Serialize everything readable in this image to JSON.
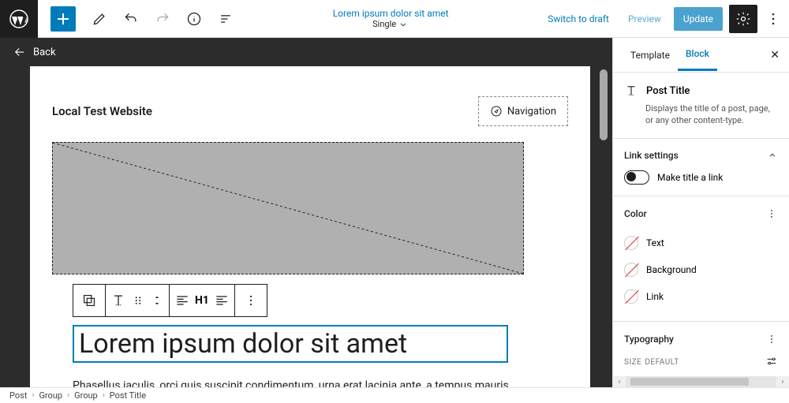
{
  "topbar": {
    "doc_title": "Lorem ipsum dolor sit amet",
    "doc_subtitle": "Single",
    "switch_draft": "Switch to draft",
    "preview": "Preview",
    "update": "Update"
  },
  "back": {
    "label": "Back"
  },
  "site": {
    "title": "Local Test Website",
    "nav_label": "Navigation"
  },
  "toolbar": {
    "heading": "H1"
  },
  "content": {
    "title": "Lorem ipsum dolor sit amet",
    "body": "Phasellus iaculis, orci quis suscipit condimentum, urna erat lacinia ante, a tempus mauris"
  },
  "sidebar": {
    "tabs": {
      "template": "Template",
      "block": "Block"
    },
    "block": {
      "name": "Post Title",
      "description": "Displays the title of a post, page, or any other content-type."
    },
    "link_settings": {
      "title": "Link settings",
      "toggle_label": "Make title a link"
    },
    "color": {
      "title": "Color",
      "text": "Text",
      "background": "Background",
      "link": "Link"
    },
    "typography": {
      "title": "Typography",
      "size_label": "SIZE",
      "size_value": "DEFAULT"
    }
  },
  "breadcrumb": {
    "post": "Post",
    "g1": "Group",
    "g2": "Group",
    "pt": "Post Title"
  }
}
